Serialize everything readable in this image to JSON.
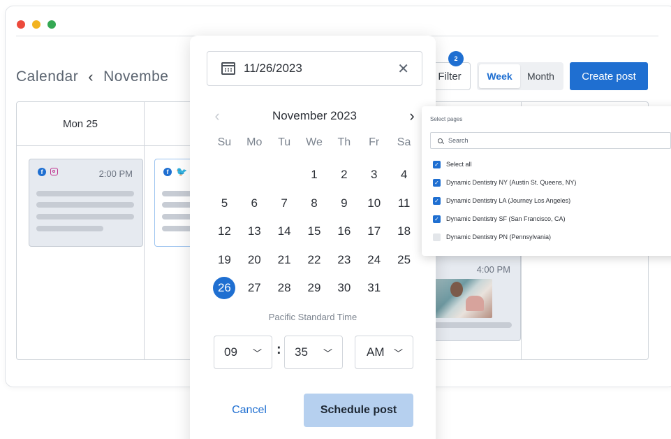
{
  "window": {
    "controls": [
      "close",
      "minimize",
      "maximize"
    ]
  },
  "calendar": {
    "title": "Calendar",
    "prev_icon": "chevron-left-icon",
    "month_partial": "Novembe",
    "filter": {
      "label": "Filter",
      "badge": "2"
    },
    "view_options": [
      {
        "label": "Week",
        "active": true
      },
      {
        "label": "Month",
        "active": false
      }
    ],
    "create_post_label": "Create post",
    "day_headers": [
      "Mon 25"
    ],
    "cards": [
      {
        "time": "2:00 PM",
        "icons": [
          "facebook-icon",
          "instagram-icon"
        ]
      },
      {
        "time": "",
        "icons": [
          "facebook-icon",
          "twitter-icon"
        ]
      },
      {
        "time": "4:00 PM",
        "icons": [
          "instagram-icon"
        ]
      }
    ]
  },
  "date_picker": {
    "date_value": "11/26/2023",
    "month_label": "November 2023",
    "weekdays": [
      "Su",
      "Mo",
      "Tu",
      "We",
      "Th",
      "Fr",
      "Sa"
    ],
    "weeks": [
      [
        "",
        "",
        "",
        "1",
        "2",
        "3",
        "4"
      ],
      [
        "5",
        "6",
        "7",
        "8",
        "9",
        "10",
        "11"
      ],
      [
        "12",
        "13",
        "14",
        "15",
        "16",
        "17",
        "18"
      ],
      [
        "19",
        "20",
        "21",
        "22",
        "23",
        "24",
        "25"
      ],
      [
        "26",
        "27",
        "28",
        "29",
        "30",
        "31",
        ""
      ]
    ],
    "selected_day": "26",
    "timezone": "Pacific Standard Time",
    "hour": "09",
    "minute": "35",
    "ampm": "AM",
    "cancel_label": "Cancel",
    "schedule_label": "Schedule post"
  },
  "pages_dropdown": {
    "title": "Select pages",
    "search_placeholder": "Search",
    "options": [
      {
        "label": "Select all",
        "checked": true
      },
      {
        "label": "Dynamic Dentistry NY (Austin St. Queens, NY)",
        "checked": true
      },
      {
        "label": "Dynamic Dentistry LA (Journey Los Angeles)",
        "checked": true
      },
      {
        "label": "Dynamic Dentistry SF (San Francisco, CA)",
        "checked": true
      },
      {
        "label": "Dynamic Dentistry PN (Pennsylvania)",
        "checked": false
      }
    ]
  },
  "colors": {
    "accent": "#1f6fd1",
    "schedule_button": "#b6d0ef",
    "card_bg": "#e6eaf0"
  }
}
